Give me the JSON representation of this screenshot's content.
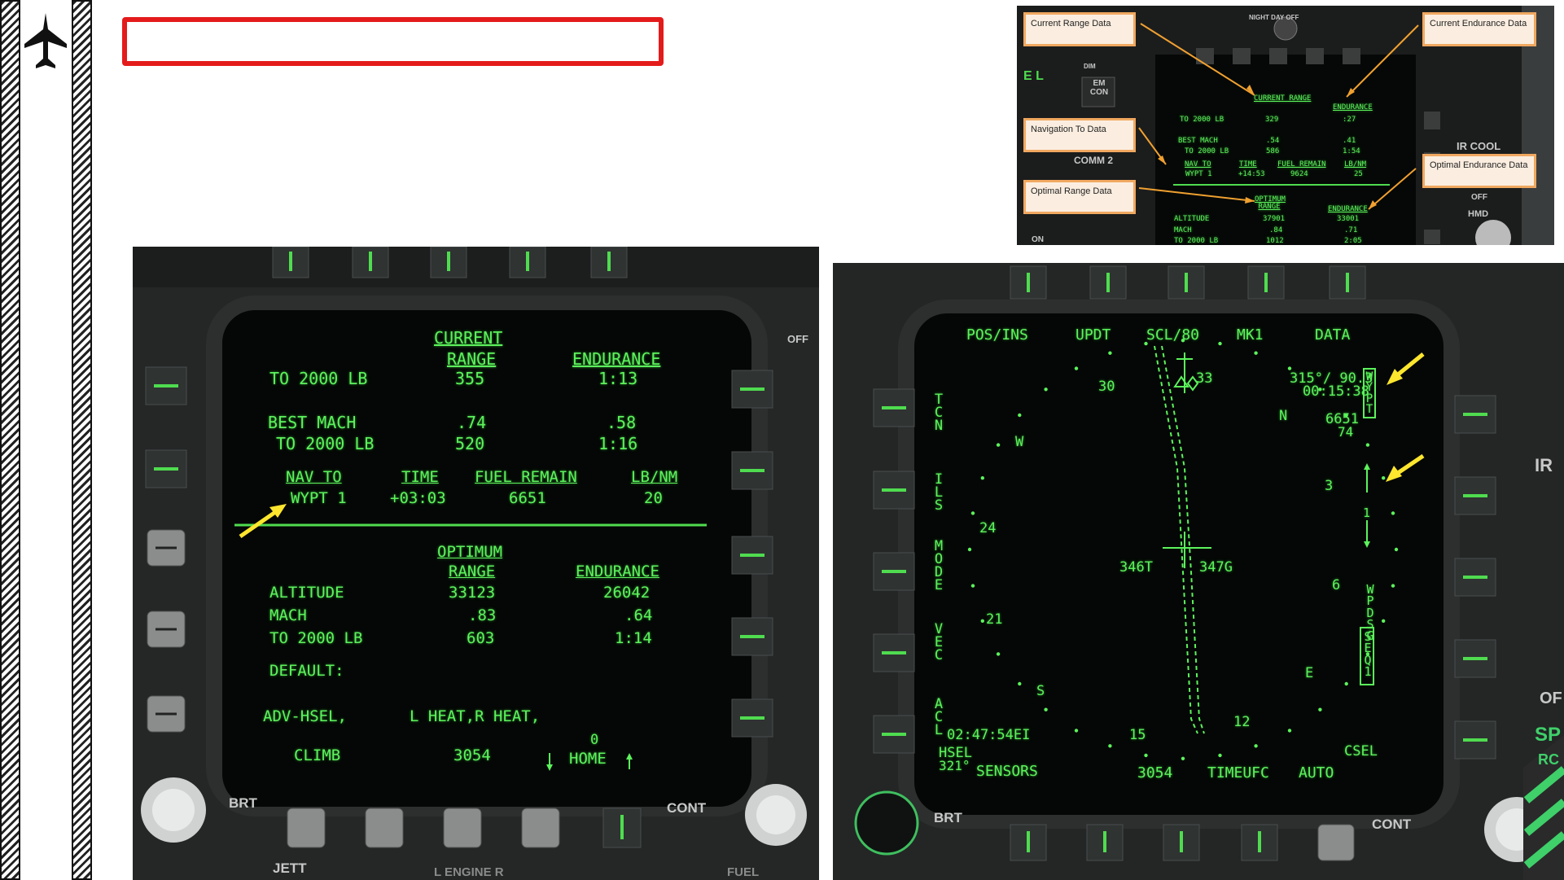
{
  "page": {
    "title_box_text": ""
  },
  "small_image": {
    "callouts": {
      "current_range": "Current Range Data",
      "current_endurance": "Current Endurance Data",
      "navigation_to": "Navigation To Data",
      "optimal_range": "Optimal Range Data",
      "optimal_endurance": "Optimal Endurance Data"
    },
    "bg_text": {
      "night_off": "NIGHT  DAY  OFF",
      "em_con": "EM CON",
      "comm2": "COMM 2",
      "ir_cool": "IR COOL",
      "off": "OFF",
      "hmd": "HMD",
      "on": "ON",
      "el": "E L",
      "dim": "DIM"
    },
    "mini": {
      "current_range_h": "CURRENT RANGE",
      "endurance_h": "ENDURANCE",
      "to_2000": "TO  2000 LB",
      "range_val": "329",
      "end_val": ":27",
      "best_mach": "BEST MACH",
      "to_2000b": "TO  2000 LB",
      "bm_range": ".54",
      "bm_end": ".41",
      "bm_range2": "586",
      "bm_end2": "1:54",
      "nav_to": "NAV TO",
      "time": "TIME",
      "fuel_remain": "FUEL REMAIN",
      "lbnm": "LB/NM",
      "wypt": "WYPT 1",
      "time_val": "+14:53",
      "fuel_val": "9624",
      "lbnm_val": "25",
      "opt_range_h": "OPTIMUM RANGE",
      "opt_end_h": "ENDURANCE",
      "altitude": "ALTITUDE",
      "mach": "MACH",
      "to_2000c": "TO  2000 LB",
      "alt_r": "37901",
      "alt_e": "33001",
      "mach_r": ".84",
      "mach_e": ".71",
      "to_r": "1012",
      "to_e": "2:05"
    }
  },
  "fuel_page": {
    "current_h1": "CURRENT",
    "current_h2": "RANGE",
    "endurance_h": "ENDURANCE",
    "to_2000": "TO  2000 LB",
    "cur_range": "355",
    "cur_end": "1:13",
    "best_mach": "BEST MACH",
    "to_2000b": "TO  2000 LB",
    "bm_range": ".74",
    "bm_end": ".58",
    "bm_range2": "520",
    "bm_end2": "1:16",
    "nav_to": "NAV TO",
    "time": "TIME",
    "fuel_remain": "FUEL REMAIN",
    "lbnm": "LB/NM",
    "wypt": "WYPT 1",
    "time_val": "+03:03",
    "fuel_val": "6651",
    "lbnm_val": "20",
    "opt_h1": "OPTIMUM",
    "opt_h2": "RANGE",
    "opt_end_h": "ENDURANCE",
    "altitude": "ALTITUDE",
    "alt_r": "33123",
    "alt_e": "26042",
    "mach": "MACH",
    "mach_r": ".83",
    "mach_e": ".64",
    "to_2000c": "TO  2000 LB",
    "to_r": "603",
    "to_e": "1:14",
    "default": "DEFAULT:",
    "adv_hsel": "ADV-HSEL,",
    "heat": "L HEAT,R HEAT,",
    "climb": "CLIMB",
    "climb_val": "3054",
    "home_zero": "0",
    "home": "HOME",
    "brt": "BRT",
    "cont": "CONT",
    "off": "OFF",
    "jett": "JETT",
    "engine": "L  ENGINE  R",
    "fuel": "FUEL"
  },
  "hsi_page": {
    "top_menu": [
      "POS/INS",
      "UPDT",
      "SCL/80",
      "MK1",
      "DATA"
    ],
    "left_vert": [
      "TCN",
      "ILS",
      "MODE",
      "VEC",
      "ACL"
    ],
    "right_vert": [
      "WYPT",
      "WPDSG",
      "SEQ1"
    ],
    "bearing": "315°/ 90.3",
    "ttg": "00:15:38",
    "fuel_wpt": "6651",
    "fuel_lb": "74",
    "wpt_num": "1",
    "compass": [
      "30",
      "33",
      "N",
      "3",
      "6",
      "E",
      "12",
      "15",
      "S",
      "21",
      "24",
      "W"
    ],
    "hdg_t": "346T",
    "hdg_g": "347G",
    "time": "02:47:54EI",
    "hsel": "HSEL",
    "hsel_val": "321°",
    "bottom_menu": [
      "SENSORS",
      "3054",
      "TIMEUFC",
      "AUTO"
    ],
    "csel": "CSEL",
    "brt": "BRT",
    "cont": "CONT",
    "ir": "IR",
    "of": "OF",
    "sp": "SP",
    "rc": "RC"
  }
}
